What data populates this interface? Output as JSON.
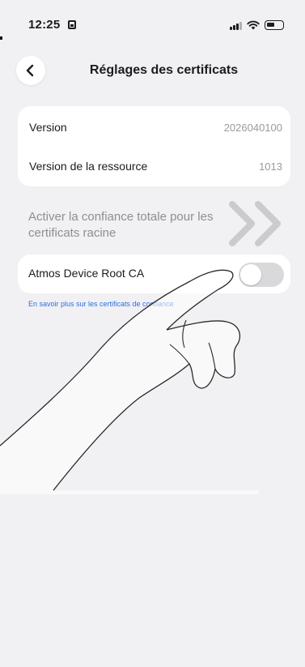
{
  "status_bar": {
    "time": "12:25",
    "icons": [
      "sim-icon",
      "signal-icon",
      "wifi-icon",
      "battery-icon"
    ]
  },
  "nav": {
    "back_icon": "chevron-left-icon",
    "title": "Réglages des certificats"
  },
  "info": {
    "rows": [
      {
        "label": "Version",
        "value": "2026040100"
      },
      {
        "label": "Version de la ressource",
        "value": "1013"
      }
    ]
  },
  "trust_section": {
    "label": "Activer la confiance totale pour les certificats racine",
    "toggle_item": {
      "label": "Atmos Device Root CA",
      "enabled": false
    },
    "learn_more": "En savoir plus sur les certificats de confiance"
  },
  "overlay": {
    "gesture_icon": "swipe-right-chevrons-icon",
    "hand_icon": "pointing-hand-icon"
  },
  "colors": {
    "background": "#f1f1f3",
    "card": "#ffffff",
    "link": "#2f6fe0",
    "secondary_text": "#8e8e93",
    "toggle_off": "#d9d9dc"
  }
}
